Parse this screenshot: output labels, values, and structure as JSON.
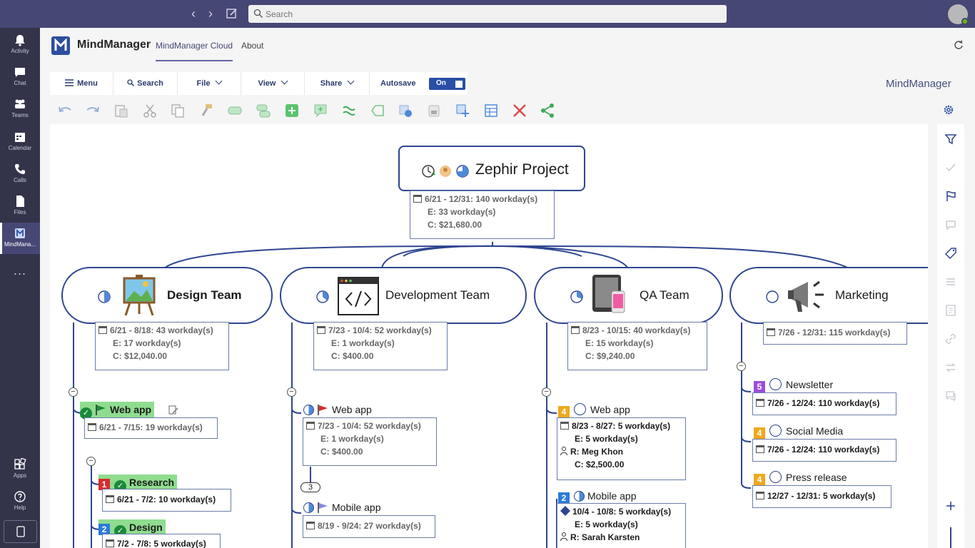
{
  "teams": {
    "search": {
      "placeholder": "Search"
    },
    "rail": [
      {
        "label": "Activity",
        "icon": "bell-icon"
      },
      {
        "label": "Chat",
        "icon": "chat-icon"
      },
      {
        "label": "Teams",
        "icon": "teams-icon"
      },
      {
        "label": "Calendar",
        "icon": "calendar-icon"
      },
      {
        "label": "Calls",
        "icon": "phone-icon"
      },
      {
        "label": "Files",
        "icon": "file-icon"
      },
      {
        "label": "MindMana...",
        "icon": "mindmanager-icon"
      }
    ],
    "rail_more": "...",
    "rail_bottom": [
      {
        "label": "Apps",
        "icon": "apps-icon"
      },
      {
        "label": "Help",
        "icon": "help-icon"
      }
    ]
  },
  "app": {
    "name": "MindManager",
    "tabs": [
      "MindManager Cloud",
      "About"
    ]
  },
  "menubar": {
    "menu": "Menu",
    "search": "Search",
    "file": "File",
    "view": "View",
    "share": "Share",
    "autosave": "Autosave",
    "autosave_state": "On",
    "brand": "MindManager"
  },
  "colors": {
    "accent": "#464775",
    "rail": "#33344a",
    "topic_border": "#2e4590",
    "highlight": "#8fdc8f"
  },
  "map": {
    "central": {
      "title": "Zephir Project",
      "info": [
        "6/21 - 12/31: 140 workday(s)",
        "E: 33 workday(s)",
        "C: $21,680.00"
      ]
    },
    "branches": [
      {
        "title": "Design Team",
        "info": [
          "6/21 - 8/18: 43 workday(s)",
          "E: 17 workday(s)",
          "C: $12,040.00"
        ],
        "subtopics": [
          {
            "title": "Web app",
            "info": [
              "6/21 - 7/15: 19 workday(s)"
            ]
          },
          {
            "title": "Research",
            "priority": "1",
            "info": [
              "6/21 - 7/2: 10 workday(s)"
            ]
          },
          {
            "title": "Design",
            "priority": "2",
            "info": [
              "7/2 - 7/8: 5 workday(s)"
            ]
          }
        ]
      },
      {
        "title": "Development Team",
        "info": [
          "7/23 - 10/4: 52 workday(s)",
          "E: 1 workday(s)",
          "C: $400.00"
        ],
        "subtopics": [
          {
            "title": "Web app",
            "info": [
              "7/23 - 10/4: 52 workday(s)",
              "E: 1 workday(s)",
              "C: $400.00"
            ]
          },
          {
            "title": "Mobile app",
            "info": [
              "8/19 - 9/24: 27 workday(s)"
            ]
          }
        ],
        "count_badge": "3"
      },
      {
        "title": "QA Team",
        "info": [
          "8/23 - 10/15: 40 workday(s)",
          "E: 15 workday(s)",
          "C: $9,240.00"
        ],
        "subtopics": [
          {
            "title": "Web app",
            "priority": "4",
            "info": [
              "8/23 - 8/27: 5 workday(s)",
              "E: 5 workday(s)",
              "R: Meg Khon",
              "C: $2,500.00"
            ]
          },
          {
            "title": "Mobile app",
            "priority": "2",
            "info": [
              "10/4 - 10/8: 5 workday(s)",
              "E: 5 workday(s)",
              "R: Sarah Karsten"
            ]
          }
        ]
      },
      {
        "title": "Marketing",
        "info": [
          "7/26 - 12/31: 115 workday(s)"
        ],
        "subtopics": [
          {
            "title": "Newsletter",
            "priority": "5",
            "info": [
              "7/26 - 12/24: 110 workday(s)"
            ]
          },
          {
            "title": "Social Media",
            "priority": "4",
            "info": [
              "7/26 - 12/24: 110 workday(s)"
            ]
          },
          {
            "title": "Press release",
            "priority": "4",
            "info": [
              "12/27 - 12/31: 5 workday(s)"
            ]
          }
        ]
      }
    ]
  }
}
